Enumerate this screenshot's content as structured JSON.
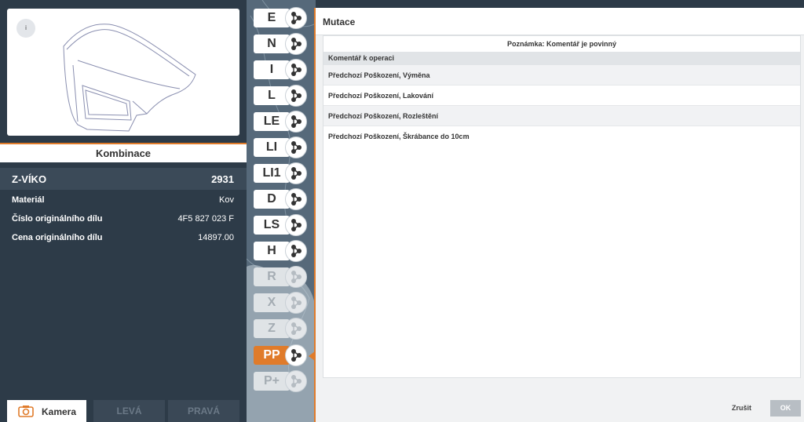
{
  "image_card": {
    "info_icon_glyph": "i",
    "part_image": "trunk-lid-drawing"
  },
  "kombinace_label": "Kombinace",
  "part": {
    "name": "Z-VÍKO",
    "code": "2931"
  },
  "properties": [
    {
      "key": "Materiál",
      "value": "Kov"
    },
    {
      "key": "Číslo originálního dílu",
      "value": "4F5 827 023 F"
    },
    {
      "key": "Cena originálního dílu",
      "value": "14897.00"
    }
  ],
  "bottom_buttons": {
    "camera": "Kamera",
    "left": "LEVÁ",
    "right": "PRAVÁ"
  },
  "operations": [
    {
      "label": "E",
      "state": "normal"
    },
    {
      "label": "N",
      "state": "normal"
    },
    {
      "label": "I",
      "state": "normal"
    },
    {
      "label": "L",
      "state": "normal"
    },
    {
      "label": "LE",
      "state": "normal"
    },
    {
      "label": "LI",
      "state": "normal"
    },
    {
      "label": "LI1",
      "state": "normal"
    },
    {
      "label": "D",
      "state": "normal"
    },
    {
      "label": "LS",
      "state": "normal"
    },
    {
      "label": "H",
      "state": "normal"
    },
    {
      "label": "R",
      "state": "dim"
    },
    {
      "label": "X",
      "state": "dim"
    },
    {
      "label": "Z",
      "state": "dim"
    },
    {
      "label": "PP",
      "state": "active"
    },
    {
      "label": "P+",
      "state": "dim"
    }
  ],
  "mutace": {
    "title": "Mutace",
    "note": "Poznámka: Komentář je povinný",
    "table_header": "Komentář k operaci",
    "rows": [
      "Předchozí Poškození, Výměna",
      "Předchozí Poškození, Lakování",
      "Předchozí Poškození, Rozleštění",
      "Předchozí Poškození, Škrábance do 10cm"
    ],
    "cancel": "Zrušit",
    "ok": "OK"
  },
  "colors": {
    "accent": "#e07b2a",
    "panel": "#2d3b48",
    "ok_button": "#b8bec4"
  }
}
